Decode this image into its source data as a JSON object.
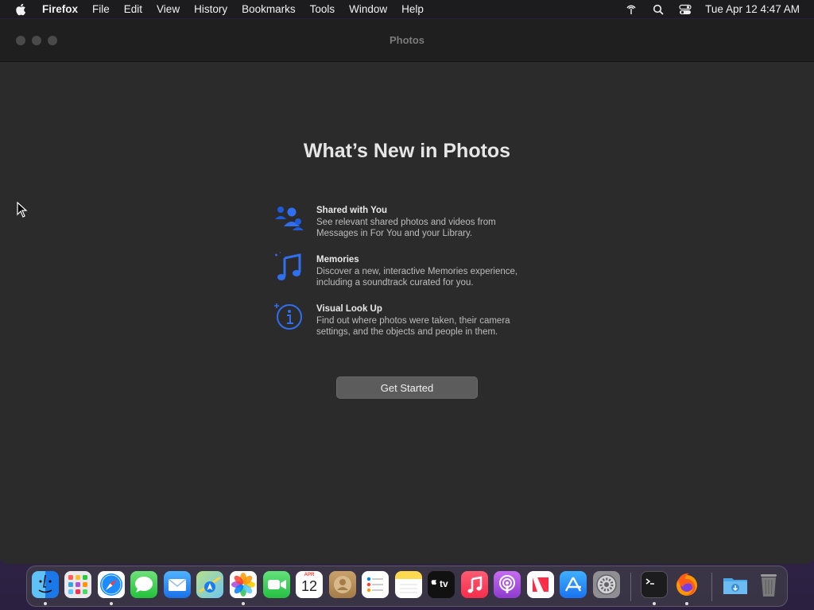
{
  "menubar": {
    "app": "Firefox",
    "items": [
      "File",
      "Edit",
      "View",
      "History",
      "Bookmarks",
      "Tools",
      "Window",
      "Help"
    ],
    "clock": "Tue Apr 12  4:47 AM",
    "icons": [
      "apple-icon",
      "airdrop-icon",
      "search-icon",
      "control-center-icon"
    ]
  },
  "window": {
    "title": "Photos"
  },
  "main": {
    "headline": "What’s New in Photos",
    "features": [
      {
        "icon": "shared-people-icon",
        "title": "Shared with You",
        "desc": "See relevant shared photos and videos from Messages in For You and your Library."
      },
      {
        "icon": "music-note-icon",
        "title": "Memories",
        "desc": "Discover a new, interactive Memories experience, including a soundtrack curated for you."
      },
      {
        "icon": "visual-lookup-icon",
        "title": "Visual Look Up",
        "desc": "Find out where photos were taken, their camera settings, and the objects and people in them."
      }
    ],
    "button": "Get Started"
  },
  "dock": {
    "apps": [
      {
        "name": "Finder",
        "color": "#2e8df5"
      },
      {
        "name": "Launchpad",
        "color": "#e5e5ea"
      },
      {
        "name": "Safari",
        "color": "#1a8cff"
      },
      {
        "name": "Messages",
        "color": "#34c759"
      },
      {
        "name": "Mail",
        "color": "#1e90ff"
      },
      {
        "name": "Maps",
        "color": "#5ac85a"
      },
      {
        "name": "Photos",
        "color": "#ffffff"
      },
      {
        "name": "FaceTime",
        "color": "#30d158"
      },
      {
        "name": "Calendar",
        "color": "#ffffff"
      },
      {
        "name": "Contacts",
        "color": "#b08a5a"
      },
      {
        "name": "Reminders",
        "color": "#ffffff"
      },
      {
        "name": "Notes",
        "color": "#fbd34d"
      },
      {
        "name": "TV",
        "color": "#111111"
      },
      {
        "name": "Music",
        "color": "#fa2d48"
      },
      {
        "name": "Podcasts",
        "color": "#9b46d8"
      },
      {
        "name": "News",
        "color": "#ffffff"
      },
      {
        "name": "App Store",
        "color": "#1c8cff"
      },
      {
        "name": "System Preferences",
        "color": "#8e8e93"
      },
      {
        "name": "Terminal",
        "color": "#1c1c1e"
      },
      {
        "name": "Firefox",
        "color": "#ff7139"
      },
      {
        "name": "Downloads",
        "color": "#4aa6e8"
      },
      {
        "name": "Trash",
        "color": "#7a7a7a"
      }
    ],
    "calendar": {
      "month": "APR",
      "day": "12"
    },
    "tv_label": "tv"
  }
}
